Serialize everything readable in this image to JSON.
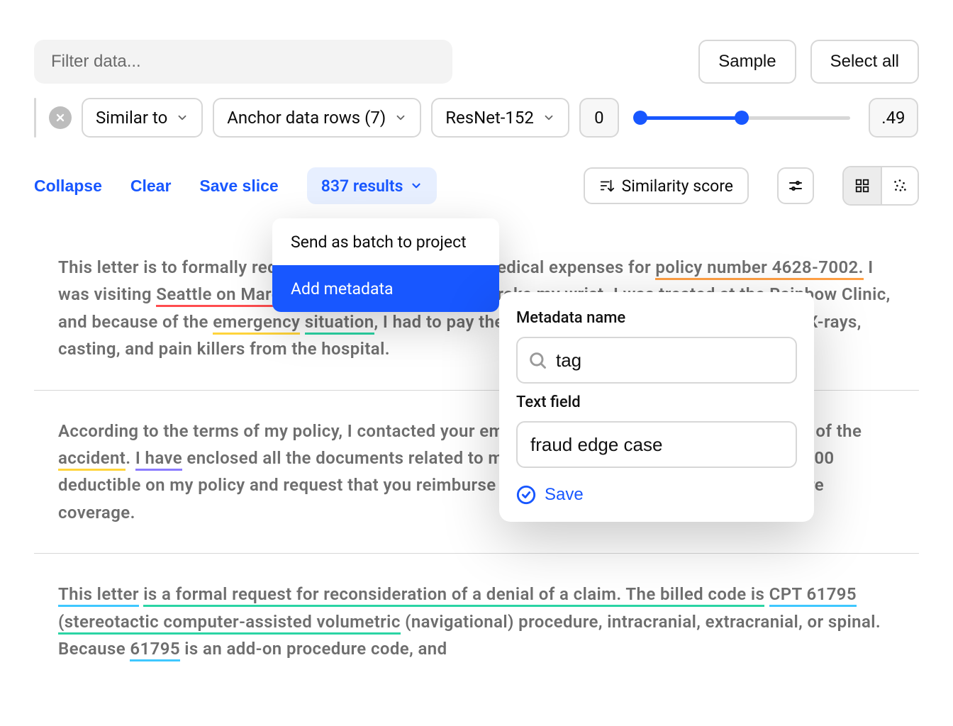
{
  "filter": {
    "placeholder": "Filter data..."
  },
  "buttons": {
    "sample": "Sample",
    "select_all": "Select all"
  },
  "similar": {
    "similar_to": "Similar to",
    "anchor": "Anchor data rows (7)",
    "model": "ResNet-152",
    "min": "0",
    "max": ".49",
    "slider_pct": 49
  },
  "actions": {
    "collapse": "Collapse",
    "clear": "Clear",
    "save_slice": "Save slice",
    "results": "837 results",
    "sort": "Similarity score"
  },
  "menu": {
    "item1": "Send as batch to project",
    "item2": "Add metadata"
  },
  "metadata": {
    "name_label": "Metadata name",
    "tag_value": "tag",
    "text_label": "Text field",
    "text_value": "fraud edge case",
    "save": "Save"
  },
  "results": [
    {
      "prefix": "This letter is to formally request a reimbursement for medical expenses for ",
      "u1": "policy number 4628-7002.",
      "c1": "orange",
      "mid1": " I was visiting ",
      "u2": "Seattle on March 29, 2023",
      "c2": "red",
      "mid2": " when I fell and broke my wrist. I was treated at the Rainbow Clinic, and because of the ",
      "u3": "emergency",
      "c3": "yellow",
      "mid3": " ",
      "u4": "situation",
      "c4": "green",
      "suffix": ", I had to pay the bill in full. The amount was $3200 for X-rays, casting, and pain killers from the hospital."
    },
    {
      "prefix": "According to the terms of my policy, I contacted your emergency phone number within 24 hours of the ",
      "u1": "accident",
      "c1": "yellow",
      "mid1": ". ",
      "u2": "I have",
      "c2": "purple",
      "mid2": " enclosed all the documents related to my treatment. I understand that I have $200 deductible on my policy and request that you reimburse me $3000 in keeping with my health care coverage.",
      "u3": "",
      "c3": "",
      "mid3": "",
      "u4": "",
      "c4": "",
      "suffix": ""
    },
    {
      "prefix": "",
      "u1": "This letter",
      "c1": "cyan",
      "mid1": " ",
      "u2": "is a formal request for reconsideration of a denial of a claim. The billed code is",
      "c2": "green",
      "mid2": " ",
      "u3": "CPT 61795",
      "c3": "cyan",
      "mid3": " ",
      "u4": "(stereotactic computer-assisted volumetric",
      "c4": "green",
      "suffix": " (navigational) procedure, intracranial, extracranial, or spinal. Because ",
      "u5": "61795",
      "c5": "cyan",
      "suffix2": " is an add-on procedure code, and"
    }
  ]
}
